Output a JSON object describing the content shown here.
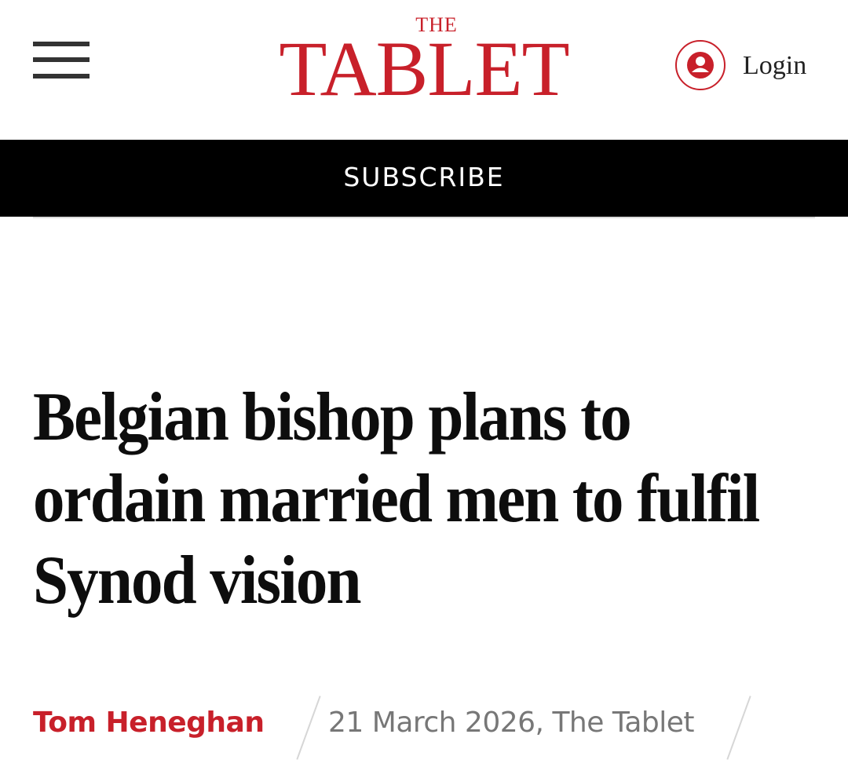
{
  "header": {
    "logo_the": "THE",
    "logo_main": "TABLET",
    "login_label": "Login",
    "brand_color": "#c8202a"
  },
  "subscribe": {
    "label": "SUBSCRIBE"
  },
  "article": {
    "headline": "Belgian bishop plans to ordain married men to fulfil Synod vision",
    "author": "Tom Heneghan",
    "dateline": "21 March 2026, The Tablet"
  },
  "icons": {
    "menu": "hamburger-menu-icon",
    "login": "user-icon"
  }
}
